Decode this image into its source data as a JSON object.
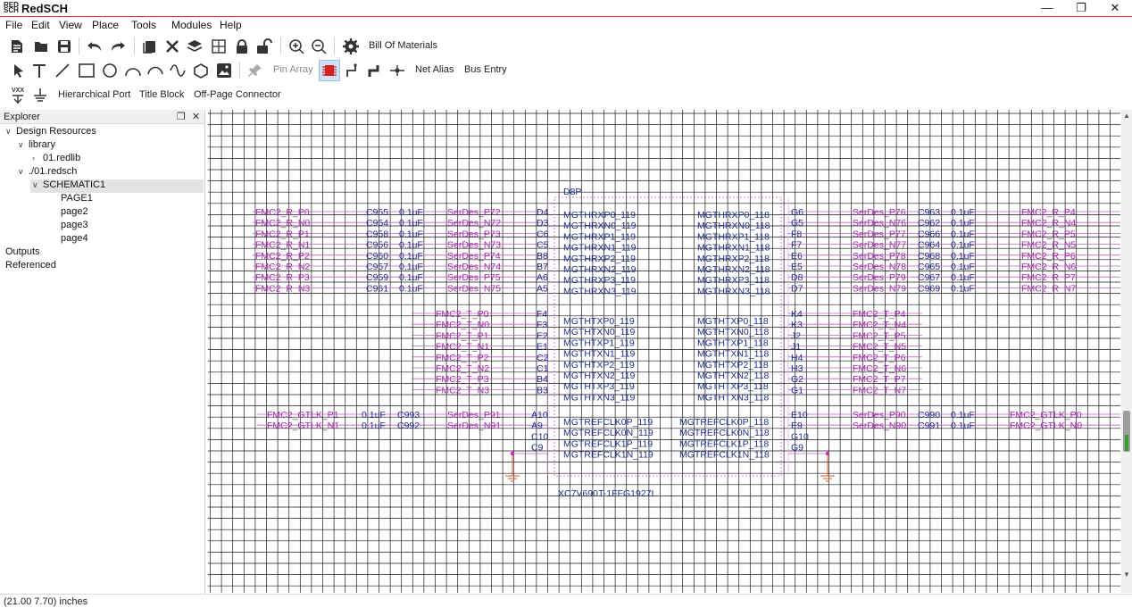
{
  "window": {
    "title": "RedSCH",
    "icon_text": "RED SCH",
    "minimize": "—",
    "maximize": "❐",
    "close": "✕"
  },
  "menu": [
    "File",
    "Edit",
    "View",
    "Place",
    "Tools",
    "Modules",
    "Help"
  ],
  "toolbar1": {
    "bom_label": "Bill Of Materials"
  },
  "toolbar2": {
    "pin_array_label": "Pin Array",
    "net_alias_label": "Net Alias",
    "bus_entry_label": "Bus Entry"
  },
  "toolbar3": {
    "vcc_label": "VXX",
    "hier_port_label": "Hierarchical Port",
    "title_block_label": "Title Block",
    "offpage_label": "Off-Page Connector"
  },
  "explorer": {
    "title": "Explorer",
    "tree": [
      {
        "label": "Design Resources",
        "level": 0,
        "chev": "v"
      },
      {
        "label": "library",
        "level": 1,
        "chev": "v"
      },
      {
        "label": "01.redlib",
        "level": 2,
        "chev": ">"
      },
      {
        "label": "./01.redsch",
        "level": 1,
        "chev": "v"
      },
      {
        "label": "SCHEMATIC1",
        "level": 2,
        "chev": "v",
        "selected": true
      },
      {
        "label": "PAGE1",
        "level": 4,
        "chev": ""
      },
      {
        "label": "page2",
        "level": 4,
        "chev": ""
      },
      {
        "label": "page3",
        "level": 4,
        "chev": ""
      },
      {
        "label": "page4",
        "level": 4,
        "chev": ""
      },
      {
        "label": "Outputs",
        "level": 0,
        "chev": ""
      },
      {
        "label": "Referenced",
        "level": 0,
        "chev": ""
      }
    ]
  },
  "schematic": {
    "colors": {
      "net": "#a02aa8",
      "part": "#1f2d8c",
      "grid": "#1a1a1a",
      "wire": "#c060c0"
    },
    "part_ref": "D8P",
    "part_value": "XC7V690T-1FFG1927I",
    "rx_left_rows": [
      {
        "port": "FMC2_R_P0",
        "cap": "C955",
        "val": "0.1uF",
        "net": "SerDes_P72",
        "pin": "D4",
        "sig": "MGTHRXP0_119"
      },
      {
        "port": "FMC2_R_N0",
        "cap": "C954",
        "val": "0.1uF",
        "net": "SerDes_N72",
        "pin": "D3",
        "sig": "MGTHRXN0_119"
      },
      {
        "port": "FMC2_R_P1",
        "cap": "C958",
        "val": "0.1uF",
        "net": "SerDes_P73",
        "pin": "C6",
        "sig": "MGTHRXP1_119"
      },
      {
        "port": "FMC2_R_N1",
        "cap": "C956",
        "val": "0.1uF",
        "net": "SerDes_N73",
        "pin": "C5",
        "sig": "MGTHRXN1_119"
      },
      {
        "port": "FMC2_R_P2",
        "cap": "C960",
        "val": "0.1uF",
        "net": "SerDes_P74",
        "pin": "B8",
        "sig": "MGTHRXP2_119"
      },
      {
        "port": "FMC2_R_N2",
        "cap": "C957",
        "val": "0.1uF",
        "net": "SerDes_N74",
        "pin": "B7",
        "sig": "MGTHRXN2_119"
      },
      {
        "port": "FMC2_R_P3",
        "cap": "C959",
        "val": "0.1uF",
        "net": "SerDes_P75",
        "pin": "A6",
        "sig": "MGTHRXP3_119"
      },
      {
        "port": "FMC2_R_N3",
        "cap": "C961",
        "val": "0.1uF",
        "net": "SerDes_N75",
        "pin": "A5",
        "sig": "MGTHRXN3_119"
      }
    ],
    "rx_right_rows": [
      {
        "sig": "MGTHRXP0_118",
        "pin": "G6",
        "net": "SerDes_P76",
        "cap": "C963",
        "val": "0.1uF",
        "port": "FMC2_R_P4"
      },
      {
        "sig": "MGTHRXN0_118",
        "pin": "G5",
        "net": "SerDes_N76",
        "cap": "C962",
        "val": "0.1uF",
        "port": "FMC2_R_N4"
      },
      {
        "sig": "MGTHRXP1_118",
        "pin": "F8",
        "net": "SerDes_P77",
        "cap": "C966",
        "val": "0.1uF",
        "port": "FMC2_R_P5"
      },
      {
        "sig": "MGTHRXN1_118",
        "pin": "F7",
        "net": "SerDes_N77",
        "cap": "C964",
        "val": "0.1uF",
        "port": "FMC2_R_N5"
      },
      {
        "sig": "MGTHRXP2_118",
        "pin": "E6",
        "net": "SerDes_P78",
        "cap": "C968",
        "val": "0.1uF",
        "port": "FMC2_R_P6"
      },
      {
        "sig": "MGTHRXN2_118",
        "pin": "E5",
        "net": "SerDes_N78",
        "cap": "C965",
        "val": "0.1uF",
        "port": "FMC2_R_N6"
      },
      {
        "sig": "MGTHRXP3_118",
        "pin": "D8",
        "net": "SerDes_P79",
        "cap": "C967",
        "val": "0.1uF",
        "port": "FMC2_R_P7"
      },
      {
        "sig": "MGTHRXN3_118",
        "pin": "D7",
        "net": "SerDes_N79",
        "cap": "C969",
        "val": "0.1uF",
        "port": "FMC2_R_N7"
      }
    ],
    "tx_left_rows": [
      {
        "port": "FMC2_T_P0",
        "pin": "F4",
        "sig": "MGTHTXP0_119"
      },
      {
        "port": "FMC2_T_N0",
        "pin": "F3",
        "sig": "MGTHTXN0_119"
      },
      {
        "port": "FMC2_T_P1",
        "pin": "E2",
        "sig": "MGTHTXP1_119"
      },
      {
        "port": "FMC2_T_N1",
        "pin": "E1",
        "sig": "MGTHTXN1_119"
      },
      {
        "port": "FMC2_T_P2",
        "pin": "C2",
        "sig": "MGTHTXP2_119"
      },
      {
        "port": "FMC2_T_N2",
        "pin": "C1",
        "sig": "MGTHTXN2_119"
      },
      {
        "port": "FMC2_T_P3",
        "pin": "B4",
        "sig": "MGTHTXP3_119"
      },
      {
        "port": "FMC2_T_N3",
        "pin": "B3",
        "sig": "MGTHTXN3_119"
      }
    ],
    "tx_right_rows": [
      {
        "sig": "MGTHTXP0_118",
        "pin": "K4",
        "port": "FMC2_T_P4"
      },
      {
        "sig": "MGTHTXN0_118",
        "pin": "K3",
        "port": "FMC2_T_N4"
      },
      {
        "sig": "MGTHTXP1_118",
        "pin": "J2",
        "port": "FMC2_T_P5"
      },
      {
        "sig": "MGTHTXN1_118",
        "pin": "J1",
        "port": "FMC2_T_N5"
      },
      {
        "sig": "MGTHTXP2_118",
        "pin": "H4",
        "port": "FMC2_T_P6"
      },
      {
        "sig": "MGTHTXN2_118",
        "pin": "H3",
        "port": "FMC2_T_N6"
      },
      {
        "sig": "MGTHTXP3_118",
        "pin": "G2",
        "port": "FMC2_T_P7"
      },
      {
        "sig": "MGTHTXN3_118",
        "pin": "G1",
        "port": "FMC2_T_N7"
      }
    ],
    "ref_left_rows": [
      {
        "port": "FMC2_GTLK_P1",
        "val": "0.1uF",
        "cap": "C993",
        "net": "SerDes_P91",
        "pin": "A10",
        "sig": "MGTREFCLK0P_119"
      },
      {
        "port": "FMC2_GTLK_N1",
        "val": "0.1uF",
        "cap": "C992",
        "net": "SerDes_N91",
        "pin": "A9",
        "sig": "MGTREFCLK0N_119"
      },
      {
        "port": "",
        "val": "",
        "cap": "",
        "net": "",
        "pin": "C10",
        "sig": "MGTREFCLK1P_119"
      },
      {
        "port": "",
        "val": "",
        "cap": "",
        "net": "",
        "pin": "C9",
        "sig": "MGTREFCLK1N_119"
      }
    ],
    "ref_right_rows": [
      {
        "sig": "MGTREFCLK0P_118",
        "pin": "E10",
        "net": "SerDes_P90",
        "cap": "C990",
        "val": "0.1uF",
        "port": "FMC2_GTLK_P0"
      },
      {
        "sig": "MGTREFCLK0N_118",
        "pin": "E9",
        "net": "SerDes_N90",
        "cap": "C991",
        "val": "0.1uF",
        "port": "FMC2_GTLK_N0"
      },
      {
        "sig": "MGTREFCLK1P_118",
        "pin": "G10",
        "net": "",
        "cap": "",
        "val": "",
        "port": ""
      },
      {
        "sig": "MGTREFCLK1N_118",
        "pin": "G9",
        "net": "",
        "cap": "",
        "val": "",
        "port": ""
      }
    ]
  },
  "status": {
    "coords": "(21.00 7.70) inches"
  }
}
